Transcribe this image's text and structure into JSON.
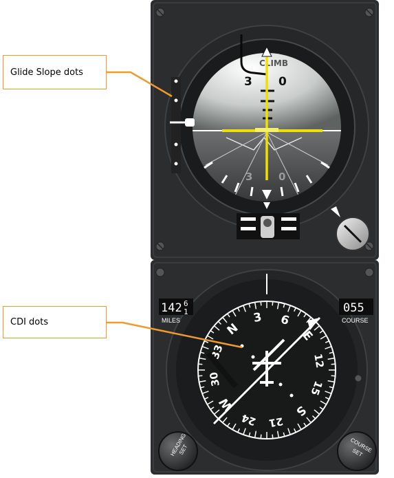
{
  "callouts": {
    "glide_slope": "Glide Slope dots",
    "cdi": "CDI dots"
  },
  "adi": {
    "climb_label": "CLIMB",
    "pitch_upper": "3",
    "pitch_upper_right": "0",
    "pitch_lower": "3",
    "pitch_lower_right": "0"
  },
  "hsi": {
    "miles_value": "142",
    "miles_digits": [
      "6",
      "1"
    ],
    "miles_label": "MILES",
    "course_value": "055",
    "course_label": "COURSE",
    "heading_knob_label": [
      "HEADING",
      "SET"
    ],
    "course_knob_label": [
      "COURSE",
      "SET"
    ],
    "compass_labels": [
      "N",
      "3",
      "6",
      "E",
      "12",
      "15",
      "S",
      "21",
      "24",
      "W",
      "30",
      "33"
    ]
  },
  "colors": {
    "callout_border": "#f09a2e",
    "panel": "#2b2d2f",
    "bezel": "#1a1b1c",
    "yellow": "#f0e000"
  }
}
